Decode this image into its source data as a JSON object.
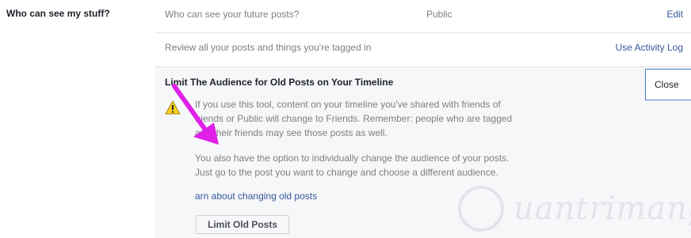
{
  "section": {
    "label": "Who can see my stuff?"
  },
  "rows": [
    {
      "text": "Who can see your future posts?",
      "value": "Public",
      "action": "Edit"
    },
    {
      "text": "Review all your posts and things you're tagged in",
      "action": "Use Activity Log"
    }
  ],
  "expanded": {
    "title": "Limit The Audience for Old Posts on Your Timeline",
    "close_label": "Close",
    "warning_icon": "warning-triangle-icon",
    "paragraph1_lines": [
      "If you use this tool, content on your timeline you've shared with friends of",
      "friends or Public will change to Friends. Remember: people who are tagged",
      "and their friends may see those posts as well."
    ],
    "paragraph2_lines": [
      "You also have the option to individually change the audience of your posts.",
      "Just go to the post you want to change and choose a different audience."
    ],
    "learn_link": "arn about changing old posts",
    "button_label": "Limit Old Posts"
  },
  "annotation": {
    "arrow_color": "#e020e8"
  },
  "watermark": {
    "text": "uantrimang"
  },
  "colors": {
    "link": "#365899",
    "muted": "#7f7f7f",
    "panel_bg": "#f6f7f9"
  }
}
